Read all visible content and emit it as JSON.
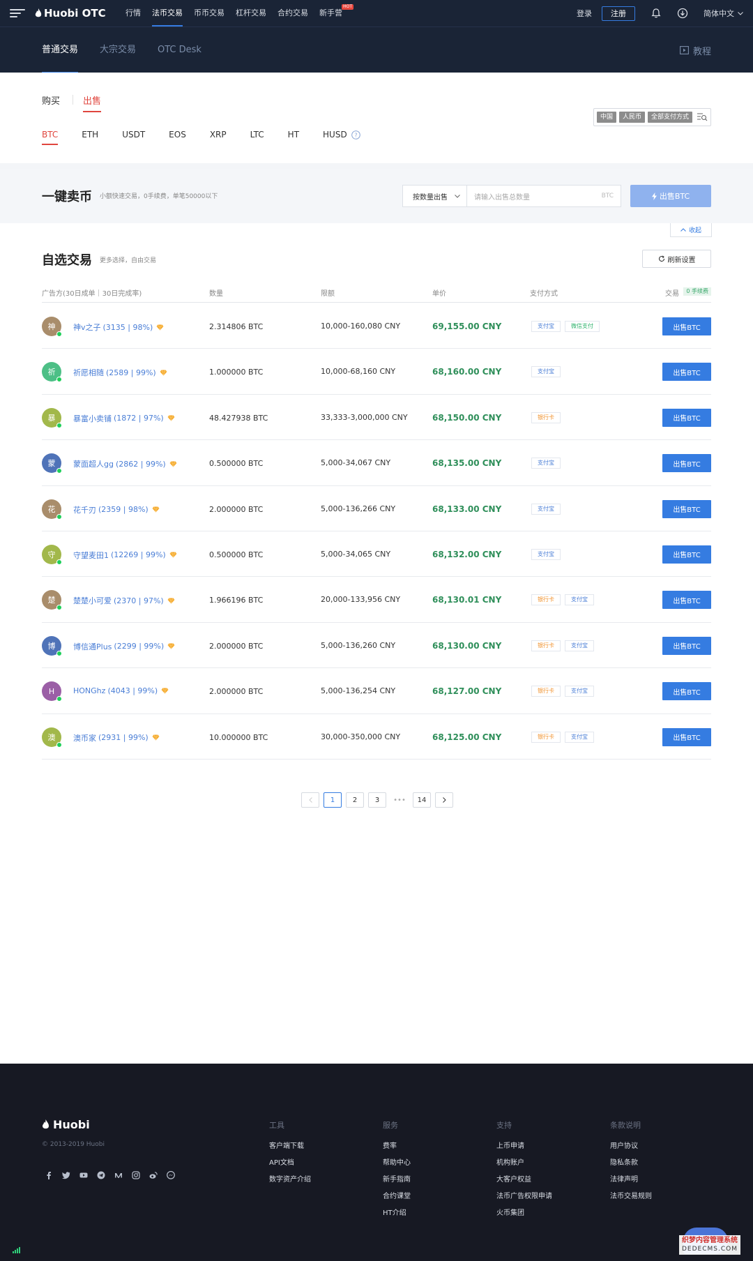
{
  "header": {
    "logo_text": "Huobi OTC",
    "nav": [
      "行情",
      "法币交易",
      "币币交易",
      "杠杆交易",
      "合约交易",
      "新手营"
    ],
    "nav_active": 1,
    "hot_badge": "HOT",
    "login": "登录",
    "register": "注册",
    "language": "简体中文"
  },
  "sub_nav": {
    "tabs": [
      "普通交易",
      "大宗交易",
      "OTC Desk"
    ],
    "active": 0,
    "tutorial": "教程"
  },
  "trade_type": {
    "buy": "购买",
    "sell": "出售",
    "active": "sell"
  },
  "coins": [
    "BTC",
    "ETH",
    "USDT",
    "EOS",
    "XRP",
    "LTC",
    "HT",
    "HUSD"
  ],
  "coin_active": "BTC",
  "filters": {
    "country": "中国",
    "currency": "人民币",
    "payment": "全部支付方式"
  },
  "quick_sell": {
    "title": "一键卖币",
    "desc": "小额快速交易，0手续费，单笔50000以下",
    "mode": "按数量出售",
    "placeholder": "请输入出售总数量",
    "unit": "BTC",
    "button": "出售BTC",
    "collapse": "收起"
  },
  "custom_trade": {
    "title": "自选交易",
    "desc": "更多选择，自由交易",
    "refresh": "刷新设置",
    "columns": {
      "merchant": "广告方(30日成单｜30日完成率)",
      "amount": "数量",
      "limit": "限额",
      "price": "单价",
      "payment": "支付方式",
      "trade": "交易",
      "fee_badge": "0 手续费"
    },
    "rows": [
      {
        "avatar": "神",
        "color": "#a98d6b",
        "name": "神v之子",
        "stats": "(3135 | 98%)",
        "amount": "2.314806 BTC",
        "limit": "10,000-160,080 CNY",
        "price": "69,155.00 CNY",
        "payments": [
          {
            "label": "支付宝",
            "type": "alipay"
          },
          {
            "label": "微信支付",
            "type": "wechat"
          }
        ],
        "action": "出售BTC"
      },
      {
        "avatar": "祈",
        "color": "#4dbf86",
        "name": "祈愿相随",
        "stats": "(2589 | 99%)",
        "amount": "1.000000 BTC",
        "limit": "10,000-68,160 CNY",
        "price": "68,160.00 CNY",
        "payments": [
          {
            "label": "支付宝",
            "type": "alipay"
          }
        ],
        "action": "出售BTC"
      },
      {
        "avatar": "暴",
        "color": "#a2b84b",
        "name": "暴富小卖铺",
        "stats": "(1872 | 97%)",
        "amount": "48.427938 BTC",
        "limit": "33,333-3,000,000 CNY",
        "price": "68,150.00 CNY",
        "payments": [
          {
            "label": "银行卡",
            "type": "bank"
          }
        ],
        "action": "出售BTC"
      },
      {
        "avatar": "蒙",
        "color": "#4f73b8",
        "name": "蒙面超人gg",
        "stats": "(2862 | 99%)",
        "amount": "0.500000 BTC",
        "limit": "5,000-34,067 CNY",
        "price": "68,135.00 CNY",
        "payments": [
          {
            "label": "支付宝",
            "type": "alipay"
          }
        ],
        "action": "出售BTC"
      },
      {
        "avatar": "花",
        "color": "#a98d6b",
        "name": "花千刃",
        "stats": "(2359 | 98%)",
        "amount": "2.000000 BTC",
        "limit": "5,000-136,266 CNY",
        "price": "68,133.00 CNY",
        "payments": [
          {
            "label": "支付宝",
            "type": "alipay"
          }
        ],
        "action": "出售BTC"
      },
      {
        "avatar": "守",
        "color": "#a2b84b",
        "name": "守望麦田1",
        "stats": "(12269 | 99%)",
        "amount": "0.500000 BTC",
        "limit": "5,000-34,065 CNY",
        "price": "68,132.00 CNY",
        "payments": [
          {
            "label": "支付宝",
            "type": "alipay"
          }
        ],
        "action": "出售BTC"
      },
      {
        "avatar": "楚",
        "color": "#a98d6b",
        "name": "楚楚小可爱",
        "stats": "(2370 | 97%)",
        "amount": "1.966196 BTC",
        "limit": "20,000-133,956 CNY",
        "price": "68,130.01 CNY",
        "payments": [
          {
            "label": "银行卡",
            "type": "bank"
          },
          {
            "label": "支付宝",
            "type": "alipay"
          }
        ],
        "action": "出售BTC"
      },
      {
        "avatar": "博",
        "color": "#4f73b8",
        "name": "博信通Plus",
        "stats": "(2299 | 99%)",
        "amount": "2.000000 BTC",
        "limit": "5,000-136,260 CNY",
        "price": "68,130.00 CNY",
        "payments": [
          {
            "label": "银行卡",
            "type": "bank"
          },
          {
            "label": "支付宝",
            "type": "alipay"
          }
        ],
        "action": "出售BTC"
      },
      {
        "avatar": "H",
        "color": "#9b5fa6",
        "name": "HONGhz",
        "stats": "(4043 | 99%)",
        "amount": "2.000000 BTC",
        "limit": "5,000-136,254 CNY",
        "price": "68,127.00 CNY",
        "payments": [
          {
            "label": "银行卡",
            "type": "bank"
          },
          {
            "label": "支付宝",
            "type": "alipay"
          }
        ],
        "action": "出售BTC"
      },
      {
        "avatar": "澳",
        "color": "#a2b84b",
        "name": "澳币家",
        "stats": "(2931 | 99%)",
        "amount": "10.000000 BTC",
        "limit": "30,000-350,000 CNY",
        "price": "68,125.00 CNY",
        "payments": [
          {
            "label": "银行卡",
            "type": "bank"
          },
          {
            "label": "支付宝",
            "type": "alipay"
          }
        ],
        "action": "出售BTC"
      }
    ]
  },
  "pagination": {
    "pages": [
      "1",
      "2",
      "3"
    ],
    "ellipsis": "•••",
    "last": "14",
    "current": "1"
  },
  "footer": {
    "logo": "Huobi",
    "copyright": "© 2013-2019 Huobi",
    "columns": [
      {
        "title": "工具",
        "links": [
          "客户端下载",
          "API文档",
          "数字资产介绍"
        ]
      },
      {
        "title": "服务",
        "links": [
          "费率",
          "帮助中心",
          "新手指南",
          "合约课堂",
          "HT介绍"
        ]
      },
      {
        "title": "支持",
        "links": [
          "上币申请",
          "机构账户",
          "大客户权益",
          "法币广告权限申请",
          "火币集团"
        ]
      },
      {
        "title": "条款说明",
        "links": [
          "用户协议",
          "隐私条款",
          "法律声明",
          "法币交易规则"
        ]
      }
    ],
    "socials": [
      "facebook-icon",
      "twitter-icon",
      "youtube-icon",
      "telegram-icon",
      "medium-icon",
      "instagram-icon",
      "weibo-icon",
      "messenger-icon"
    ]
  },
  "watermark": {
    "title": "织梦内容管理系统",
    "url": "DEDECMS.COM"
  },
  "colors": {
    "header_bg": "#1a2436",
    "accent": "#357ce1",
    "sell_red": "#e0463e",
    "price_green": "#2f8f5a"
  }
}
